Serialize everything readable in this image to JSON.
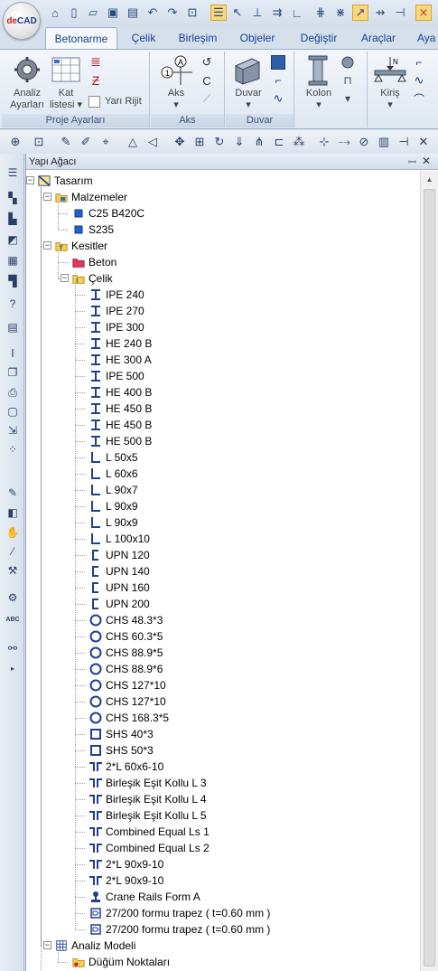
{
  "app": {
    "logo_text_a": "de",
    "logo_text_b": "CAD"
  },
  "ribbon_tabs": [
    "Betonarme",
    "Çelik",
    "Birleşim",
    "Objeler",
    "Değiştir",
    "Araçlar",
    "Aya"
  ],
  "ribbon": {
    "proje": {
      "label": "Proje Ayarları",
      "analiz_line1": "Analiz",
      "analiz_line2": "Ayarları",
      "kat_line1": "Kat",
      "kat_line2": "listesi",
      "yari_rijit": "Yarı Rijit"
    },
    "aks": {
      "label": "Aks",
      "button": "Aks"
    },
    "duvar": {
      "label": "Duvar",
      "button": "Duvar"
    },
    "kolon": {
      "button": "Kolon"
    },
    "kiris": {
      "button": "Kiriş"
    }
  },
  "panel": {
    "title": "Yapı Ağacı",
    "pin": "ꟷ",
    "close": "✕"
  },
  "tree": [
    {
      "label": "Tasarım",
      "level": 0,
      "icon": "design-icon",
      "expander": "−"
    },
    {
      "label": "Malzemeler",
      "level": 1,
      "icon": "folder-icon",
      "expander": "−"
    },
    {
      "label": "C25 B420C",
      "level": 2,
      "icon": "material-icon"
    },
    {
      "label": "S235",
      "level": 2,
      "icon": "material-icon"
    },
    {
      "label": "Kesitler",
      "level": 1,
      "icon": "sections-icon",
      "expander": "−"
    },
    {
      "label": "Beton",
      "level": 2,
      "icon": "concrete-icon"
    },
    {
      "label": "Çelik",
      "level": 2,
      "icon": "steel-icon",
      "expander": "−"
    },
    {
      "label": "IPE 240",
      "level": 3,
      "icon": "i-section-icon"
    },
    {
      "label": "IPE 270",
      "level": 3,
      "icon": "i-section-icon"
    },
    {
      "label": "IPE 300",
      "level": 3,
      "icon": "i-section-icon"
    },
    {
      "label": "HE 240 B",
      "level": 3,
      "icon": "i-section-icon"
    },
    {
      "label": "HE 300 A",
      "level": 3,
      "icon": "i-section-icon"
    },
    {
      "label": "IPE 500",
      "level": 3,
      "icon": "i-section-icon"
    },
    {
      "label": "HE 400 B",
      "level": 3,
      "icon": "i-section-icon"
    },
    {
      "label": "HE 450 B",
      "level": 3,
      "icon": "i-section-icon"
    },
    {
      "label": "HE 450 B",
      "level": 3,
      "icon": "i-section-icon"
    },
    {
      "label": "HE 500 B",
      "level": 3,
      "icon": "i-section-icon"
    },
    {
      "label": "L 50x5",
      "level": 3,
      "icon": "angle-section-icon"
    },
    {
      "label": "L 60x6",
      "level": 3,
      "icon": "angle-section-icon"
    },
    {
      "label": "L 90x7",
      "level": 3,
      "icon": "angle-section-icon"
    },
    {
      "label": "L 90x9",
      "level": 3,
      "icon": "angle-section-icon"
    },
    {
      "label": "L 90x9",
      "level": 3,
      "icon": "angle-section-icon"
    },
    {
      "label": "L 100x10",
      "level": 3,
      "icon": "angle-section-icon"
    },
    {
      "label": "UPN 120",
      "level": 3,
      "icon": "channel-section-icon"
    },
    {
      "label": "UPN 140",
      "level": 3,
      "icon": "channel-section-icon"
    },
    {
      "label": "UPN 160",
      "level": 3,
      "icon": "channel-section-icon"
    },
    {
      "label": "UPN 200",
      "level": 3,
      "icon": "channel-section-icon"
    },
    {
      "label": "CHS 48.3*3",
      "level": 3,
      "icon": "circular-section-icon"
    },
    {
      "label": "CHS 60.3*5",
      "level": 3,
      "icon": "circular-section-icon"
    },
    {
      "label": "CHS 88.9*5",
      "level": 3,
      "icon": "circular-section-icon"
    },
    {
      "label": "CHS 88.9*6",
      "level": 3,
      "icon": "circular-section-icon"
    },
    {
      "label": "CHS 127*10",
      "level": 3,
      "icon": "circular-section-icon"
    },
    {
      "label": "CHS 127*10",
      "level": 3,
      "icon": "circular-section-icon"
    },
    {
      "label": "CHS 168.3*5",
      "level": 3,
      "icon": "circular-section-icon"
    },
    {
      "label": "SHS 40*3",
      "level": 3,
      "icon": "square-section-icon"
    },
    {
      "label": "SHS 50*3",
      "level": 3,
      "icon": "square-section-icon"
    },
    {
      "label": "2*L 60x6-10",
      "level": 3,
      "icon": "double-angle-section-icon"
    },
    {
      "label": "Birleşik Eşit Kollu L 3",
      "level": 3,
      "icon": "double-angle-section-icon"
    },
    {
      "label": "Birleşik Eşit Kollu L 4",
      "level": 3,
      "icon": "double-angle-section-icon"
    },
    {
      "label": "Birleşik Eşit Kollu L 5",
      "level": 3,
      "icon": "double-angle-section-icon"
    },
    {
      "label": "Combined Equal Ls 1",
      "level": 3,
      "icon": "double-angle-section-icon"
    },
    {
      "label": "Combined Equal Ls 2",
      "level": 3,
      "icon": "double-angle-section-icon"
    },
    {
      "label": "2*L 90x9-10",
      "level": 3,
      "icon": "double-angle-section-icon"
    },
    {
      "label": "2*L 90x9-10",
      "level": 3,
      "icon": "double-angle-section-icon"
    },
    {
      "label": "Crane Rails Form A",
      "level": 3,
      "icon": "crane-rail-icon"
    },
    {
      "label": "27/200 formu trapez ( t=0.60 mm )",
      "level": 3,
      "icon": "trapezoid-deck-icon"
    },
    {
      "label": "27/200 formu trapez ( t=0.60 mm )",
      "level": 3,
      "icon": "trapezoid-deck-icon"
    },
    {
      "label": "Analiz Modeli",
      "level": 1,
      "icon": "analysis-model-icon",
      "expander": "−"
    },
    {
      "label": "Düğüm Noktaları",
      "level": 2,
      "icon": "nodes-folder-icon"
    }
  ],
  "colors": {
    "accent": "#15428b",
    "section_icon": "#1f3f8f",
    "material": "#1f5fd8"
  }
}
